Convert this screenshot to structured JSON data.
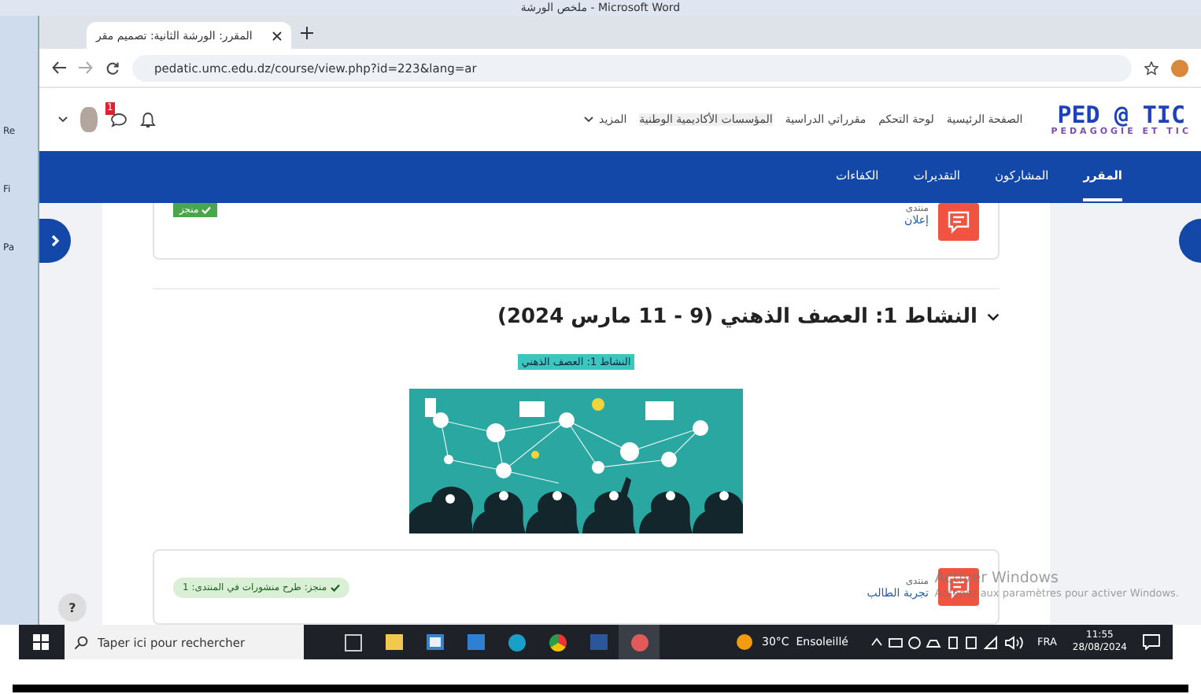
{
  "word_window": {
    "title": "ملخص الورشة - Microsoft Word",
    "side_labels": [
      "Re",
      "Fi",
      "Pa"
    ]
  },
  "browser": {
    "tab_title": "المقرر: الورشة الثانية: تصميم مقر",
    "url": "pedatic.umc.edu.dz/course/view.php?id=223&lang=ar"
  },
  "site": {
    "logo": "PED @ TIC",
    "logo_subtitle": "PEDAGOGIE ET TIC",
    "nav": [
      {
        "label": "الصفحة الرئيسية",
        "highlighted": false
      },
      {
        "label": "لوحة التحكم",
        "highlighted": false
      },
      {
        "label": "مقرراتي الدراسية",
        "highlighted": false
      },
      {
        "label": "المؤسسات الأكاديمية الوطنية",
        "highlighted": true
      },
      {
        "label": "المزيد",
        "highlighted": false
      }
    ],
    "notification_count": "1"
  },
  "course_tabs": [
    {
      "label": "المقرر",
      "selected": true
    },
    {
      "label": "المشاركون",
      "selected": false
    },
    {
      "label": "التقديرات",
      "selected": false
    },
    {
      "label": "الكفاءات",
      "selected": false
    }
  ],
  "top_activity": {
    "type_label": "منتدى",
    "name": "إعلان",
    "completion": {
      "label": "منجز",
      "completed": true
    }
  },
  "section": {
    "title": "النشاط 1: العصف الذهني (9 - 11 مارس 2024)",
    "image_caption": "النشاط 1: العصف الذهني"
  },
  "bottom_activity": {
    "type_label": "منتدى",
    "name": "تجربة الطالب",
    "completion": {
      "label": "منجز: طرح منشورات في المنتدى: 1",
      "completed": true
    }
  },
  "help_button": "?",
  "activation_notice": {
    "title": "Activer Windows",
    "text": "Accédez aux paramètres pour activer Windows."
  },
  "taskbar": {
    "search_placeholder": "Taper ici pour rechercher",
    "weather": "30°C  Ensoleillé",
    "language": "FRA",
    "time": "11:55",
    "date": "28/08/2024"
  }
}
